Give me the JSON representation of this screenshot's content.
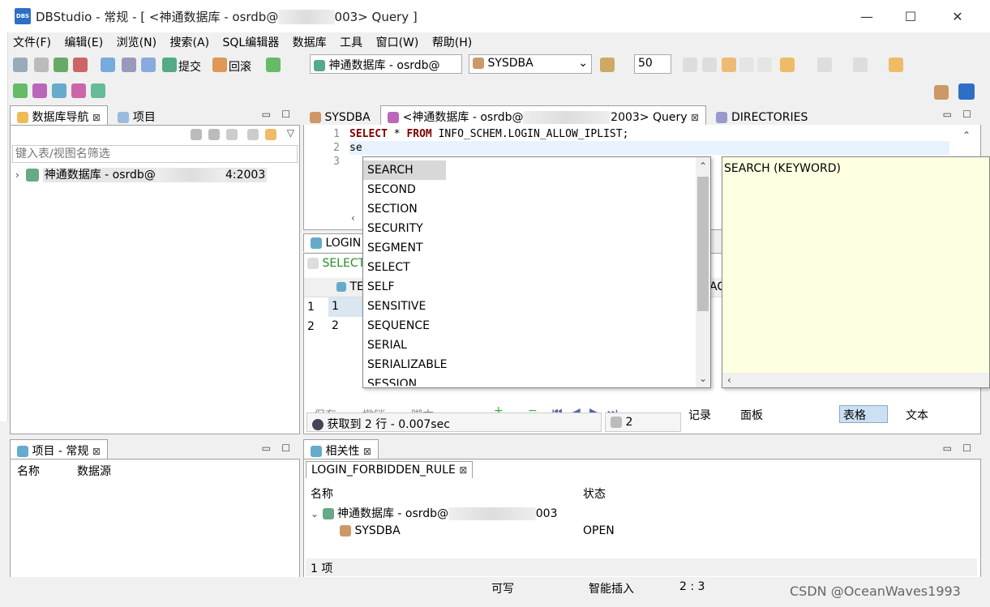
{
  "window": {
    "title": "DBStudio - 常规 - [ <神通数据库 - osrdb@",
    "title_suffix": "003> Query ]",
    "logo": "DBS",
    "minimize": "—",
    "maximize": "☐",
    "close": "✕"
  },
  "menu": [
    "文件(F)",
    "编辑(E)",
    "浏览(N)",
    "搜索(A)",
    "SQL编辑器",
    "数据库",
    "工具",
    "窗口(W)",
    "帮助(H)"
  ],
  "toolbar": {
    "commit_label": "提交",
    "rollback_label": "回滚",
    "connection_value": "神通数据库 - osrdb@",
    "schema_value": "SYSDBA",
    "limit_value": "50"
  },
  "navigator": {
    "tab_label": "数据库导航",
    "project_tab_label": "项目",
    "filter_placeholder": "键入表/视图名筛选",
    "tree_item": "神通数据库 - osrdb@",
    "tree_item_suffix": "4:2003"
  },
  "editor_tabs": [
    {
      "label": "SYSDBA"
    },
    {
      "label": "<神通数据库 - osrdb@",
      "suffix": "2003> Query"
    },
    {
      "label": "DIRECTORIES"
    }
  ],
  "editor": {
    "line_numbers": [
      "1",
      "2",
      "3"
    ],
    "line1_kw1": "SELECT",
    "line1_mid": " * ",
    "line1_kw2": "FROM",
    "line1_rest": " INFO_SCHEM.LOGIN_ALLOW_IPLIST;",
    "line2": "se"
  },
  "autocomplete": {
    "items": [
      "SEARCH",
      "SECOND",
      "SECTION",
      "SECURITY",
      "SEGMENT",
      "SELECT",
      "SELF",
      "SENSITIVE",
      "SEQUENCE",
      "SERIAL",
      "SERIALIZABLE",
      "SESSION"
    ],
    "selected_index": 0,
    "detail": "SEARCH (KEYWORD)"
  },
  "results": {
    "tab_label": "LOGIN",
    "query_preview": "SELECT",
    "col_header": "TE",
    "col_header_right": "AC",
    "rows": [
      {
        "num": "1",
        "val": "1"
      },
      {
        "num": "2",
        "val": "2"
      }
    ],
    "actions": {
      "save": "保存",
      "undo": "撤销",
      "script": "脚本",
      "record": "记录",
      "panel": "面板",
      "grid": "表格",
      "text": "文本"
    },
    "status": "获取到 2 行 - 0.007sec",
    "count": "2"
  },
  "project_panel": {
    "tab_label": "项目 - 常规",
    "col_name": "名称",
    "col_source": "数据源"
  },
  "related_panel": {
    "tab_label": "相关性",
    "subtab_label": "LOGIN_FORBIDDEN_RULE",
    "col_name": "名称",
    "col_status": "状态",
    "tree_root": "神通数据库 - osrdb@",
    "tree_root_suffix": "003",
    "child_name": "SYSDBA",
    "child_status": "OPEN",
    "footer": "1 项"
  },
  "statusbar": {
    "writable": "可写",
    "insert_mode": "智能插入",
    "position": "2 : 3",
    "watermark": "CSDN @OceanWaves1993"
  },
  "colors": {
    "accent": "#2d6fc5",
    "keyword": "#7f0055",
    "detail_bg": "#ffffe1",
    "selection": "#d8d8d8"
  }
}
